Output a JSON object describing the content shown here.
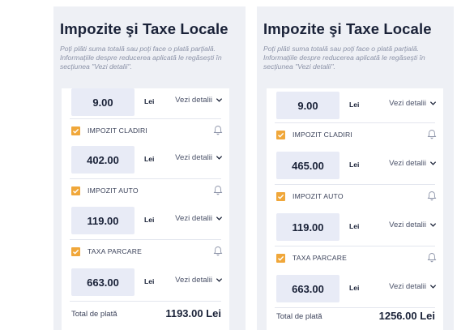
{
  "left": {
    "title": "Impozite şi Taxe Locale",
    "subtitle": "Poţi plăti suma totală sau poţi face o plată parţială. Informaţiile despre reducerea aplicată le regăseşti în secţiunea \"Vezi detalii\".",
    "first_amount": "9.00",
    "taxes": [
      {
        "name": "IMPOZIT CLADIRI",
        "amount": "402.00",
        "checked": true
      },
      {
        "name": "IMPOZIT AUTO",
        "amount": "119.00",
        "checked": true
      },
      {
        "name": "TAXA PARCARE",
        "amount": "663.00",
        "checked": true
      }
    ],
    "currency": "Lei",
    "details_label": "Vezi detalii",
    "total_label": "Total de plată",
    "total_value": "1193.00 Lei"
  },
  "right": {
    "title": "Impozite şi Taxe Locale",
    "subtitle": "Poţi plăti suma totală sau poţi face o plată parţială. Informaţiile despre reducerea aplicată le regăseşti în secţiunea \"Vezi detalii\".",
    "first_amount": "9.00",
    "taxes": [
      {
        "name": "IMPOZIT CLADIRI",
        "amount": "465.00",
        "checked": true
      },
      {
        "name": "IMPOZIT AUTO",
        "amount": "119.00",
        "checked": true
      },
      {
        "name": "TAXA PARCARE",
        "amount": "663.00",
        "checked": true
      }
    ],
    "currency": "Lei",
    "details_label": "Vezi detalii",
    "total_label": "Total de plată",
    "total_value": "1256.00 Lei"
  },
  "colors": {
    "accent_checkbox": "#f0a73a",
    "amount_box_bg": "#e8ebf6",
    "panel_bg": "#eef0f5",
    "title_text": "#1a2238"
  },
  "icons": {
    "checkbox": "check-icon",
    "notification": "bell-icon",
    "expand": "chevron-down-icon"
  }
}
